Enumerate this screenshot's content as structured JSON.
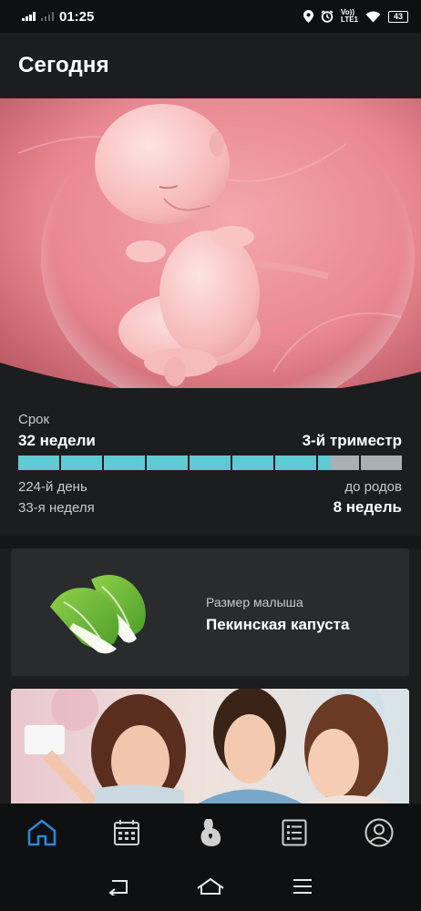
{
  "status_bar": {
    "time": "01:25",
    "network_label": "LTE1",
    "operator_label": "Vo))",
    "battery": "43"
  },
  "header": {
    "title": "Сегодня"
  },
  "pregnancy": {
    "term_label": "Срок",
    "weeks": "32 недели",
    "trimester": "3-й триместр",
    "progress": {
      "filled_segments": 7.3,
      "total_segments": 9
    },
    "day": "224-й день",
    "current_week": "33-я неделя",
    "until_birth_label": "до родов",
    "until_birth_value": "8 недель"
  },
  "baby_size": {
    "label": "Размер малыша",
    "value": "Пекинская капуста",
    "icon": "chinese-cabbage-icon"
  },
  "tabs": [
    {
      "name": "home",
      "icon": "home-icon",
      "active": true
    },
    {
      "name": "calendar",
      "icon": "calendar-icon",
      "active": false
    },
    {
      "name": "pregnancy",
      "icon": "pregnant-belly-icon",
      "active": false
    },
    {
      "name": "checklist",
      "icon": "checklist-icon",
      "active": false
    },
    {
      "name": "profile",
      "icon": "profile-icon",
      "active": false
    }
  ],
  "colors": {
    "accent": "#5ecad4",
    "active_tab": "#2f86d6",
    "background": "#1c1d1f",
    "card": "#2a2b2d"
  }
}
